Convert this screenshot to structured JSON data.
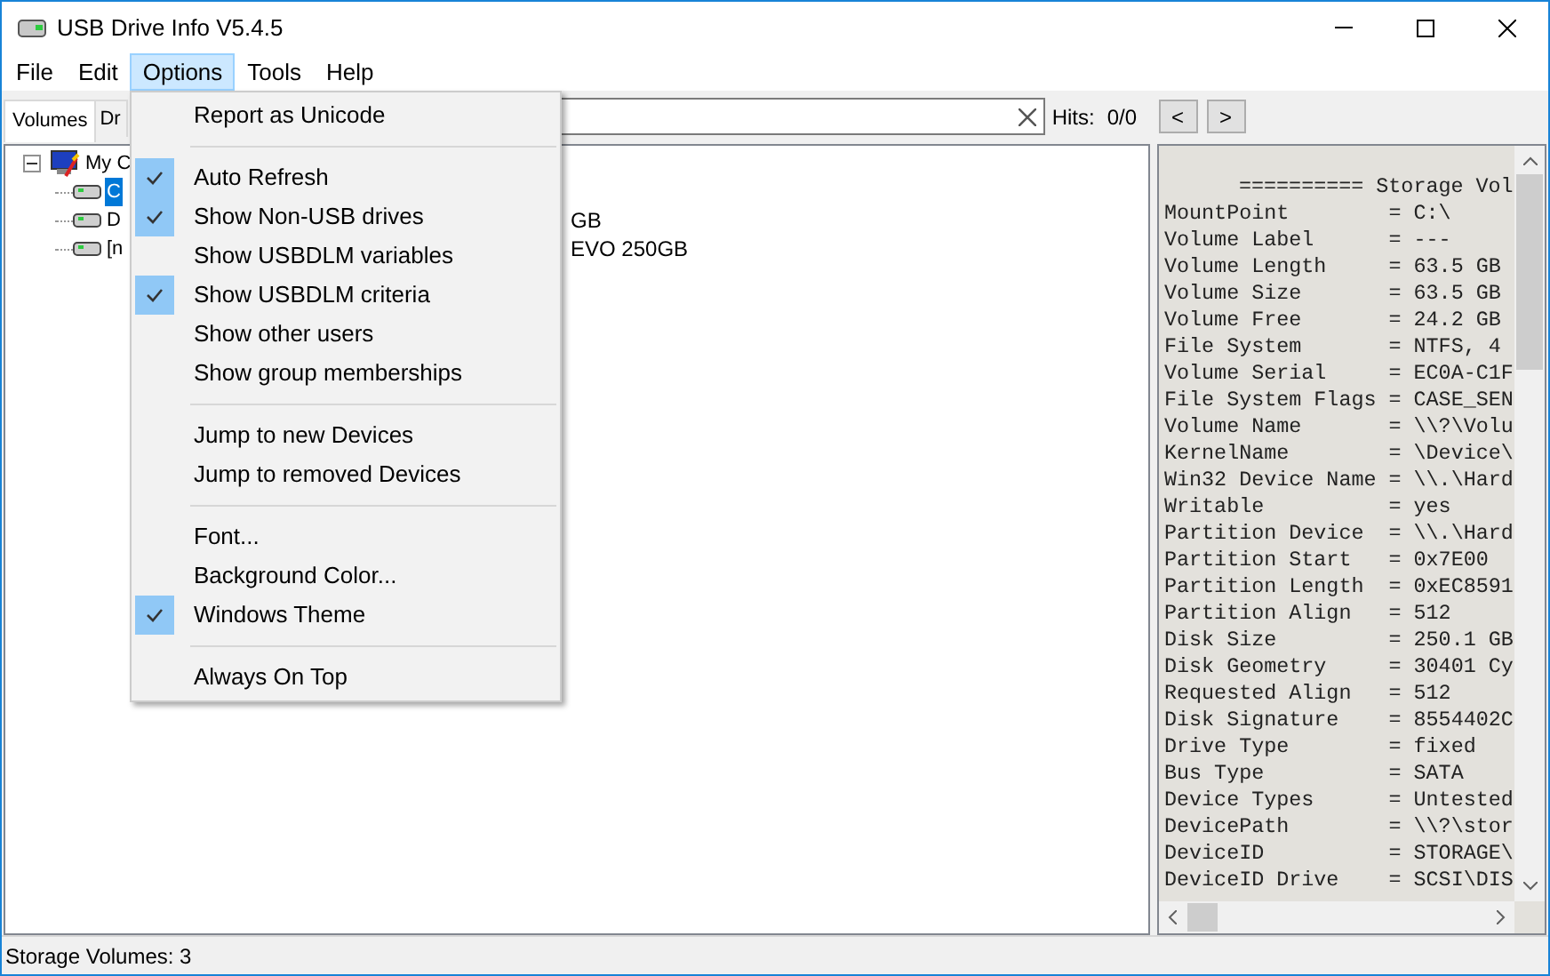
{
  "window": {
    "title": "USB Drive Info V5.4.5"
  },
  "menu_bar": [
    {
      "label": "File",
      "selected": false
    },
    {
      "label": "Edit",
      "selected": false
    },
    {
      "label": "Options",
      "selected": true
    },
    {
      "label": "Tools",
      "selected": false
    },
    {
      "label": "Help",
      "selected": false
    }
  ],
  "options_menu": [
    {
      "kind": "item",
      "label": "Report as Unicode",
      "checked": false
    },
    {
      "kind": "separator"
    },
    {
      "kind": "item",
      "label": "Auto Refresh",
      "checked": true
    },
    {
      "kind": "item",
      "label": "Show Non-USB drives",
      "checked": true
    },
    {
      "kind": "item",
      "label": "Show USBDLM variables",
      "checked": false
    },
    {
      "kind": "item",
      "label": "Show USBDLM criteria",
      "checked": true
    },
    {
      "kind": "item",
      "label": "Show other users",
      "checked": false
    },
    {
      "kind": "item",
      "label": "Show group memberships",
      "checked": false
    },
    {
      "kind": "separator"
    },
    {
      "kind": "item",
      "label": "Jump to new Devices",
      "checked": false
    },
    {
      "kind": "item",
      "label": "Jump to removed Devices",
      "checked": false
    },
    {
      "kind": "separator"
    },
    {
      "kind": "item",
      "label": "Font...",
      "checked": false
    },
    {
      "kind": "item",
      "label": "Background Color...",
      "checked": false
    },
    {
      "kind": "item",
      "label": "Windows Theme",
      "checked": true
    },
    {
      "kind": "separator"
    },
    {
      "kind": "item",
      "label": "Always On Top",
      "checked": false
    }
  ],
  "tabs": [
    {
      "label": "Volumes",
      "selected": true
    },
    {
      "label": "Dr",
      "selected": false
    }
  ],
  "search": {
    "hits_label": "Hits:",
    "hits": "0/0",
    "buttons": [
      "<",
      ">"
    ]
  },
  "tree": {
    "label": "My C",
    "expanded": true,
    "children": [
      {
        "label": "C",
        "selected": true
      },
      {
        "label": "D",
        "selected": false,
        "label_tail": "GB"
      },
      {
        "label": "[n",
        "selected": false,
        "label_tail": "EVO 250GB"
      }
    ]
  },
  "details": {
    "header": "========== Storage Vol",
    "lines": [
      "MountPoint        = C:\\",
      "Volume Label      = ---",
      "Volume Length     = 63.5 GB",
      "Volume Size       = 63.5 GB",
      "Volume Free       = 24.2 GB",
      "File System       = NTFS, 4",
      "Volume Serial     = EC0A-C1F",
      "File System Flags = CASE_SEN",
      "Volume Name       = \\\\?\\Volu",
      "KernelName        = \\Device\\",
      "Win32 Device Name = \\\\.\\Hard",
      "Writable          = yes",
      "Partition Device  = \\\\.\\Hard",
      "Partition Start   = 0x7E00",
      "Partition Length  = 0xEC8591",
      "Partition Align   = 512",
      "Disk Size         = 250.1 GB",
      "Disk Geometry     = 30401 Cy",
      "Requested Align   = 512",
      "Disk Signature    = 8554402C",
      "Drive Type        = fixed",
      "Bus Type          = SATA",
      "Device Types      = Untested",
      "DevicePath        = \\\\?\\stor",
      "DeviceID          = STORAGE\\",
      "DeviceID Drive    = SCSI\\DIS"
    ]
  },
  "status_bar": "Storage Volumes: 3"
}
